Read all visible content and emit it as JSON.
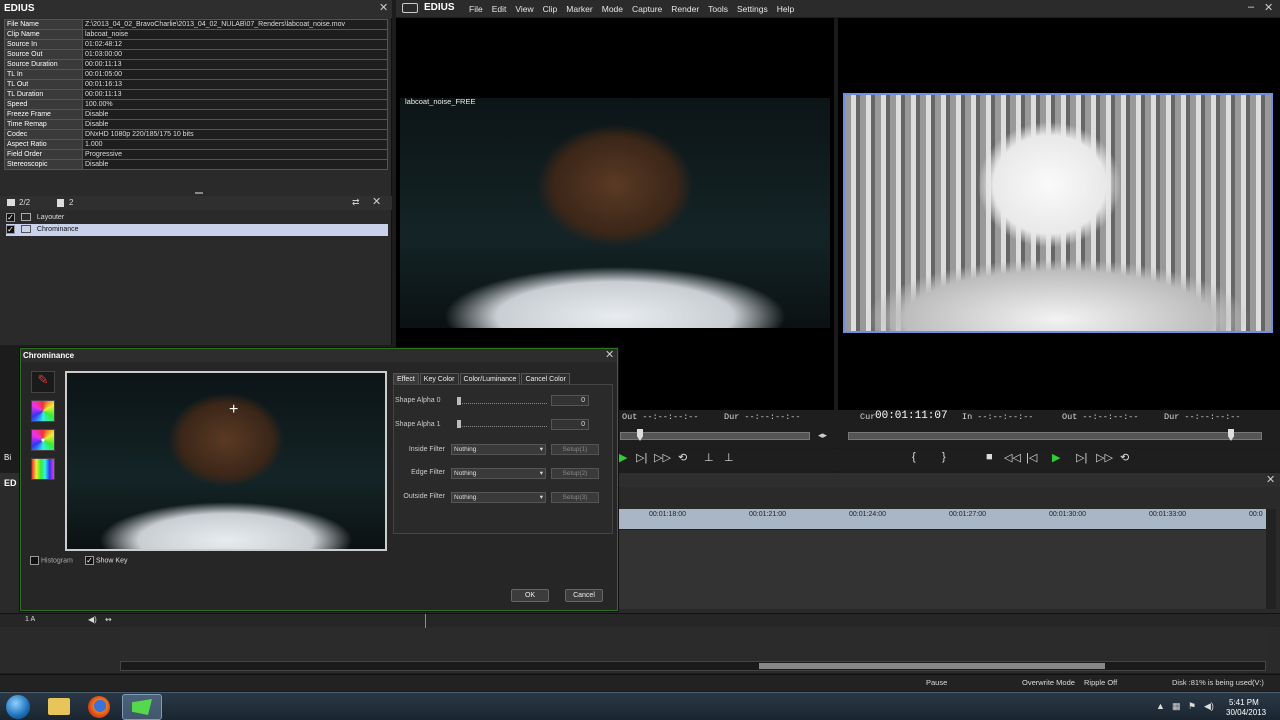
{
  "info_panel": {
    "title": "EDIUS",
    "rows": [
      {
        "k": "File Name",
        "v": "Z:\\2013_04_02_BravoCharlie\\2013_04_02_NULAB\\07_Renders\\labcoat_noise.mov"
      },
      {
        "k": "Clip Name",
        "v": "labcoat_noise"
      },
      {
        "k": "Source In",
        "v": "01:02:48:12"
      },
      {
        "k": "Source Out",
        "v": "01:03:00:00"
      },
      {
        "k": "Source Duration",
        "v": "00:00:11:13"
      },
      {
        "k": "TL In",
        "v": "00:01:05:00"
      },
      {
        "k": "TL Out",
        "v": "00:01:16:13"
      },
      {
        "k": "TL Duration",
        "v": "00:00:11:13"
      },
      {
        "k": "Speed",
        "v": "100.00%"
      },
      {
        "k": "Freeze Frame",
        "v": "Disable"
      },
      {
        "k": "Time Remap",
        "v": "Disable"
      },
      {
        "k": "Codec",
        "v": "DNxHD 1080p 220/185/175 10 bits"
      },
      {
        "k": "Aspect Ratio",
        "v": "1.000"
      },
      {
        "k": "Field Order",
        "v": "Progressive"
      },
      {
        "k": "Stereoscopic",
        "v": "Disable"
      }
    ],
    "filter_count_a": "2/2",
    "filter_count_b": "2",
    "filters": [
      {
        "label": "Layouter"
      },
      {
        "label": "Chrominance"
      }
    ]
  },
  "menubar": {
    "app": "EDIUS",
    "items": [
      "File",
      "Edit",
      "View",
      "Clip",
      "Marker",
      "Mode",
      "Capture",
      "Render",
      "Tools",
      "Settings",
      "Help"
    ]
  },
  "player": {
    "clip_label": "labcoat_noise_FREE",
    "out_label": "Out --:--:--:--",
    "dur_label": "Dur --:--:--:--"
  },
  "recorder": {
    "cur_label": "Cur",
    "cur_time": "00:01:11:07",
    "in_label": "In --:--:--:--",
    "out_label": "Out --:--:--:--",
    "dur_label": "Dur --:--:--:--"
  },
  "dialog": {
    "title": "Chrominance",
    "tabs": [
      "Effect",
      "Key Color",
      "Color/Luminance",
      "Cancel Color"
    ],
    "shape_alpha_0_label": "Shape Alpha 0",
    "shape_alpha_0_value": "0",
    "shape_alpha_1_label": "Shape Alpha 1",
    "shape_alpha_1_value": "0",
    "inside_filter_label": "Inside Filter",
    "inside_filter_value": "Nothing",
    "inside_setup": "Setup(1)",
    "edge_filter_label": "Edge Filter",
    "edge_filter_value": "Nothing",
    "edge_setup": "Setup(2)",
    "outside_filter_label": "Outside Filter",
    "outside_filter_value": "Nothing",
    "outside_setup": "Setup(3)",
    "histogram_label": "Histogram",
    "show_key_label": "Show Key",
    "ok_label": "OK",
    "cancel_label": "Cancel"
  },
  "timeline": {
    "side_label_a": "Bi",
    "side_label_b": "ED",
    "track_label": "1 A",
    "ruler": [
      "00:01:18:00",
      "00:01:21:00",
      "00:01:24:00",
      "00:01:27:00",
      "00:01:30:00",
      "00:01:33:00",
      "00:0"
    ]
  },
  "statusbar": {
    "pause": "Pause",
    "overwrite": "Overwrite Mode",
    "ripple": "Ripple Off",
    "disk": "Disk :81% is being used(V:)"
  },
  "taskbar": {
    "time": "5:41 PM",
    "date": "30/04/2013"
  },
  "colors": {
    "accent_green": "#33cc33",
    "selected_row": "#c9d2ea",
    "dialog_border": "#2f6f24"
  }
}
